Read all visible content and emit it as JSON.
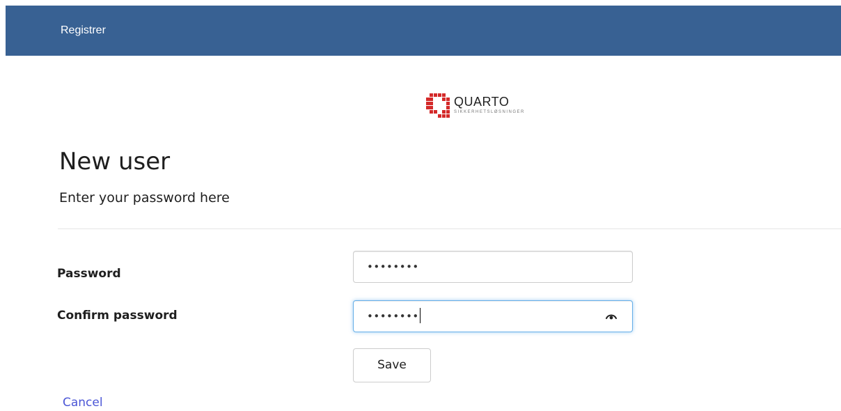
{
  "header": {
    "title": "Registrer",
    "background_color": "#386193"
  },
  "logo": {
    "wordmark": "QUARTO",
    "tagline": "SIKKERHETSLØSNINGER",
    "mark_icon": "quarto-logo-mark",
    "brand_color": "#d42a2a"
  },
  "page": {
    "title": "New user",
    "subtitle": "Enter your password here"
  },
  "form": {
    "password": {
      "label": "Password",
      "value": "••••••••"
    },
    "confirm_password": {
      "label": "Confirm password",
      "value": "••••••••",
      "focused": true,
      "reveal_icon": "eye-icon"
    },
    "save_label": "Save",
    "cancel_label": "Cancel"
  },
  "colors": {
    "link": "#4b56d6",
    "focus_border": "#66afe9"
  }
}
